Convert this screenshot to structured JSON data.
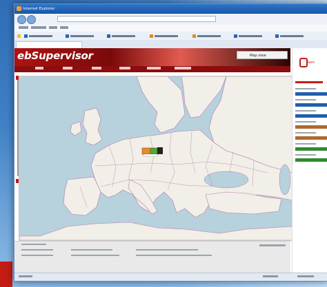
{
  "window": {
    "title": "Internet Explorer"
  },
  "app": {
    "brand": "ebSupervisor",
    "view_button": "Map view",
    "side_logo": "Gem"
  },
  "colors": {
    "header_red": "#b01212",
    "nav_red": "#8b0d0d",
    "sea": "#b7d1dd",
    "land": "#f1efe8",
    "borders": "#b77aa8",
    "badge_blue": "#1f5fad",
    "badge_brown": "#b06a2a",
    "badge_green": "#2e8b2e"
  },
  "side_badges": [
    {
      "color": "#1f5fad"
    },
    {
      "color": "#1f5fad"
    },
    {
      "color": "#1f5fad"
    },
    {
      "color": "#b06a2a"
    },
    {
      "color": "#b06a2a"
    },
    {
      "color": "#2e8b2e"
    },
    {
      "color": "#2e8b2e"
    }
  ],
  "icons": {
    "back": "back-arrow-icon",
    "forward": "forward-arrow-icon",
    "zoom_in": "plus-icon",
    "zoom_out": "minus-icon",
    "map_marker": "map-marker-icon"
  }
}
